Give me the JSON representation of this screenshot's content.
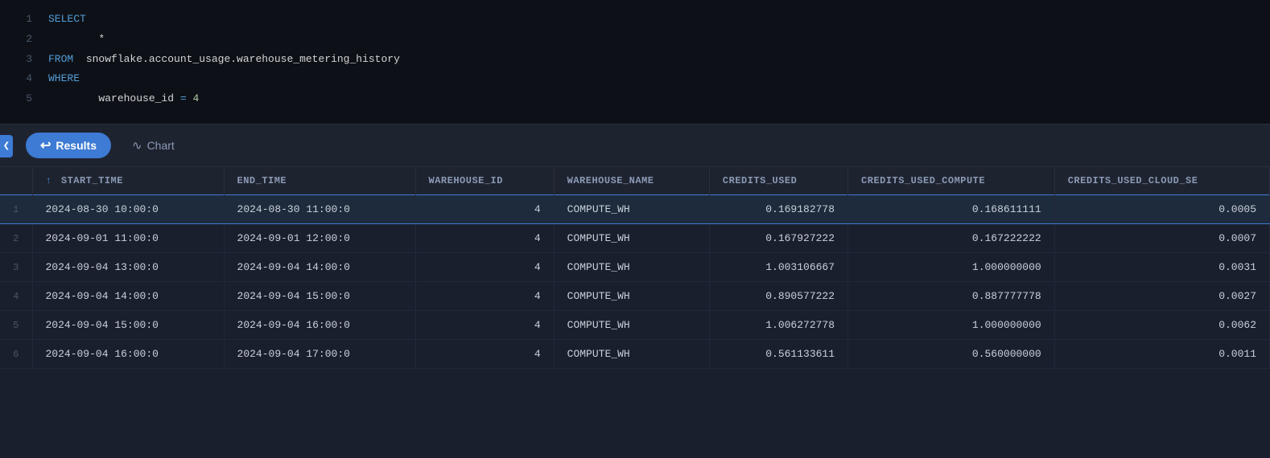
{
  "editor": {
    "lines": [
      {
        "num": 1,
        "content": "SELECT",
        "type": "keyword"
      },
      {
        "num": 2,
        "content": "        *",
        "type": "plain"
      },
      {
        "num": 3,
        "content": "FROM  snowflake.account_usage.warehouse_metering_history",
        "type": "from"
      },
      {
        "num": 4,
        "content": "WHERE",
        "type": "keyword"
      },
      {
        "num": 5,
        "content": "        warehouse_id = 4",
        "type": "where-clause"
      }
    ]
  },
  "tabs": {
    "results_label": "Results",
    "chart_label": "Chart"
  },
  "table": {
    "columns": [
      {
        "id": "row_num",
        "label": "",
        "sortable": false
      },
      {
        "id": "start_time",
        "label": "START_TIME",
        "sortable": true
      },
      {
        "id": "end_time",
        "label": "END_TIME",
        "sortable": false
      },
      {
        "id": "warehouse_id",
        "label": "WAREHOUSE_ID",
        "sortable": false
      },
      {
        "id": "warehouse_name",
        "label": "WAREHOUSE_NAME",
        "sortable": false
      },
      {
        "id": "credits_used",
        "label": "CREDITS_USED",
        "sortable": false
      },
      {
        "id": "credits_used_compute",
        "label": "CREDITS_USED_COMPUTE",
        "sortable": false
      },
      {
        "id": "credits_used_cloud_se",
        "label": "CREDITS_USED_CLOUD_SE",
        "sortable": false
      }
    ],
    "rows": [
      {
        "row_num": 1,
        "start_time": "2024-08-30 10:00:0",
        "end_time": "2024-08-30 11:00:0",
        "warehouse_id": "4",
        "warehouse_name": "COMPUTE_WH",
        "credits_used": "0.169182778",
        "credits_used_compute": "0.168611111",
        "credits_used_cloud_se": "0.0005"
      },
      {
        "row_num": 2,
        "start_time": "2024-09-01 11:00:0",
        "end_time": "2024-09-01 12:00:0",
        "warehouse_id": "4",
        "warehouse_name": "COMPUTE_WH",
        "credits_used": "0.167927222",
        "credits_used_compute": "0.167222222",
        "credits_used_cloud_se": "0.0007"
      },
      {
        "row_num": 3,
        "start_time": "2024-09-04 13:00:0",
        "end_time": "2024-09-04 14:00:0",
        "warehouse_id": "4",
        "warehouse_name": "COMPUTE_WH",
        "credits_used": "1.003106667",
        "credits_used_compute": "1.000000000",
        "credits_used_cloud_se": "0.0031"
      },
      {
        "row_num": 4,
        "start_time": "2024-09-04 14:00:0",
        "end_time": "2024-09-04 15:00:0",
        "warehouse_id": "4",
        "warehouse_name": "COMPUTE_WH",
        "credits_used": "0.890577222",
        "credits_used_compute": "0.887777778",
        "credits_used_cloud_se": "0.0027"
      },
      {
        "row_num": 5,
        "start_time": "2024-09-04 15:00:0",
        "end_time": "2024-09-04 16:00:0",
        "warehouse_id": "4",
        "warehouse_name": "COMPUTE_WH",
        "credits_used": "1.006272778",
        "credits_used_compute": "1.000000000",
        "credits_used_cloud_se": "0.0062"
      },
      {
        "row_num": 6,
        "start_time": "2024-09-04 16:00:0",
        "end_time": "2024-09-04 17:00:0",
        "warehouse_id": "4",
        "warehouse_name": "COMPUTE_WH",
        "credits_used": "0.561133611",
        "credits_used_compute": "0.560000000",
        "credits_used_cloud_se": "0.0011"
      }
    ]
  }
}
